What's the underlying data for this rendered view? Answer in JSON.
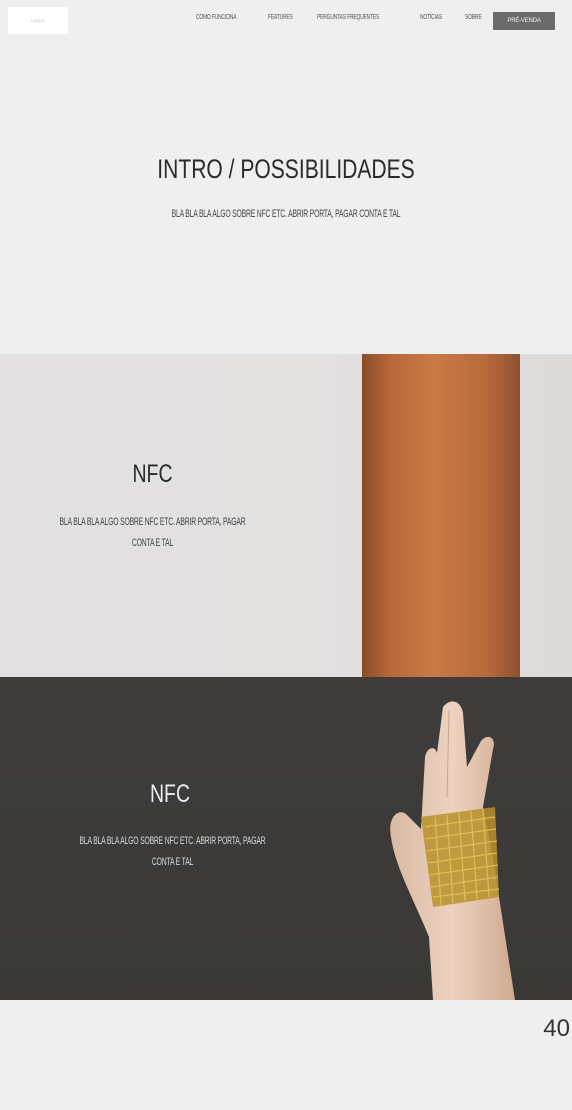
{
  "nav": {
    "logo": "LOGO",
    "links": [
      {
        "label": "COMO FUNCIONA"
      },
      {
        "label": "FEATURES"
      },
      {
        "label": "PERGUNTAS FREQUENTES"
      },
      {
        "label": "NOTÍCIAS"
      },
      {
        "label": "SOBRE"
      }
    ],
    "cta_label": "PRÉ-VENDA"
  },
  "intro": {
    "title": "INTRO / POSSIBILIDADES",
    "text": "BLA BLA BLA ALGO SOBRE NFC ETC. ABRIR PORTA, PAGAR CONTA E TAL"
  },
  "section1": {
    "title": "NFC",
    "text_line1": "BLA BLA BLA ALGO SOBRE NFC ETC. ABRIR PORTA, PAGAR",
    "text_line2": "CONTA E TAL"
  },
  "section2": {
    "title": "NFC",
    "text_line1": "BLA BLA BLA ALGO SOBRE NFC ETC. ABRIR PORTA, PAGAR",
    "text_line2": "CONTA E TAL"
  },
  "footer": {
    "page_number": "40"
  },
  "colors": {
    "background": "#efefef",
    "cta": "#6b6b6b",
    "dark_section": "#3c3b39",
    "gold": "#c9a227",
    "silver": "#b9bcc2"
  }
}
